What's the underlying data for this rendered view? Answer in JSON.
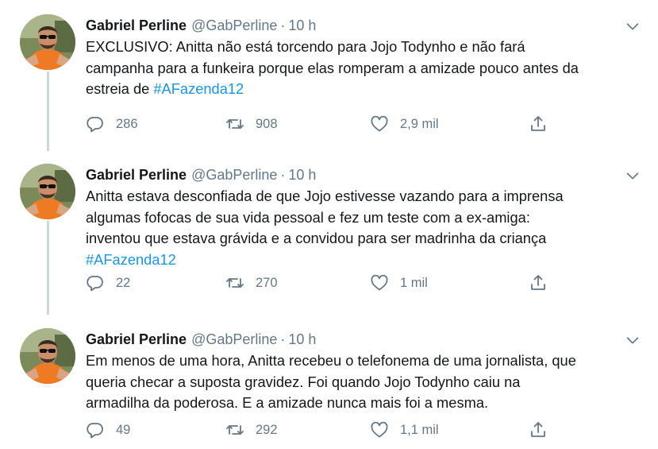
{
  "tweets": [
    {
      "author_name": "Gabriel Perline",
      "handle": "@GabPerline",
      "separator": "·",
      "time": "10 h",
      "text_lines": [
        "EXCLUSIVO: Anitta não está torcendo para Jojo Todynho e não fará",
        "campanha para a funkeira porque elas romperam a amizade pouco antes da",
        "estreia de "
      ],
      "hashtag": "#AFazenda12",
      "replies": "286",
      "retweets": "908",
      "likes": "2,9 mil"
    },
    {
      "author_name": "Gabriel Perline",
      "handle": "@GabPerline",
      "separator": "·",
      "time": "10 h",
      "text_lines": [
        "Anitta estava desconfiada de que Jojo estivesse vazando para a imprensa",
        "algumas fofocas de sua vida pessoal e fez um teste com a ex-amiga:",
        "inventou que estava grávida e a convidou para ser madrinha da criança"
      ],
      "hashtag": "#AFazenda12",
      "replies": "22",
      "retweets": "270",
      "likes": "1 mil"
    },
    {
      "author_name": "Gabriel Perline",
      "handle": "@GabPerline",
      "separator": "·",
      "time": "10 h",
      "text_lines": [
        "Em menos de uma hora, Anitta recebeu o telefonema de uma jornalista, que",
        "queria checar a suposta gravidez. Foi quando Jojo Todynho caiu na",
        "armadilha da poderosa. E a amizade nunca mais foi a mesma."
      ],
      "replies": "49",
      "retweets": "292",
      "likes": "1,1 mil"
    }
  ],
  "icons": {
    "reply": "reply-icon",
    "retweet": "retweet-icon",
    "like": "heart-icon",
    "share": "share-icon",
    "menu": "chevron-down-icon"
  },
  "colors": {
    "text": "#14171a",
    "secondary": "#657786",
    "link": "#1b95e0",
    "thread_line": "#ccd6dd",
    "avatar_shirt": "#ee7a24"
  }
}
